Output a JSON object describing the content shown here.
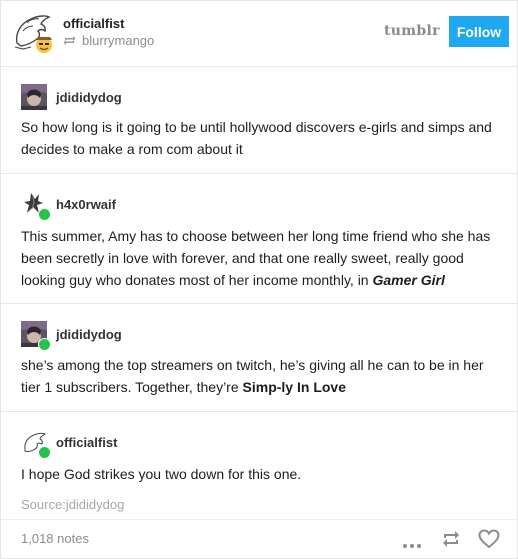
{
  "header": {
    "poster": "officialfist",
    "reblogged_from": "blurrymango",
    "wordmark": "tumblr",
    "follow_label": "Follow"
  },
  "posts": [
    {
      "username": "jdididydog",
      "text": "So how long is it going to be until hollywood discovers e-girls and simps and decides to make a rom com about it"
    },
    {
      "username": "h4x0rwaif",
      "text_before": "This summer, Amy has to choose between her long time friend who she has been secretly in love with forever, and that one really sweet, really good looking guy who donates most of her income monthly, in ",
      "title": "Gamer Girl"
    },
    {
      "username": "jdididydog",
      "text_before": "she’s among the top streamers on twitch, he’s giving all he can to be in her tier 1 subscribers. Together, they’re ",
      "title": "Simp-ly In Love"
    },
    {
      "username": "officialfist",
      "text": "I hope God strikes you two down for this one."
    }
  ],
  "source": "Source:jdididydog",
  "notes": "1,018 notes",
  "icons": {
    "more": "more-dots-icon",
    "reblog": "reblog-icon",
    "like": "heart-icon",
    "badge": "green-reblog-badge"
  },
  "colors": {
    "follow_button": "#1fa7f0",
    "badge": "#27c24c",
    "muted_text": "#8c8c8c"
  }
}
